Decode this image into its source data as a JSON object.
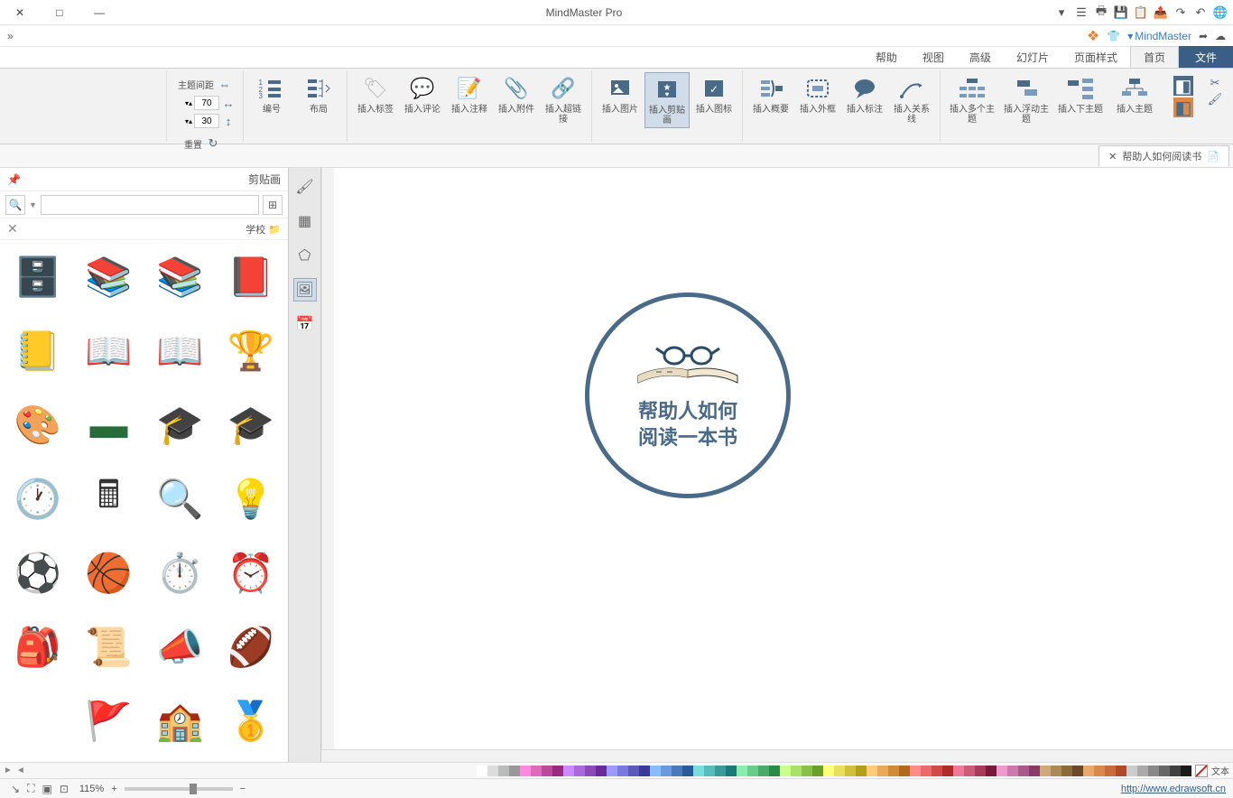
{
  "app": {
    "title": "MindMaster Pro"
  },
  "window_controls": {
    "min": "—",
    "max": "□",
    "close": "✕"
  },
  "titlebar_icons": [
    "globe",
    "undo",
    "redo",
    "export",
    "paste",
    "save",
    "print",
    "menu",
    "drop"
  ],
  "quickbar": {
    "doc_name": "MindMaster",
    "cloud": "☁",
    "share": "➦",
    "shirt": "👕",
    "logo": "❖",
    "expand": "«"
  },
  "menu": {
    "file": "文件",
    "tabs": [
      "首页",
      "页面样式",
      "幻灯片",
      "高级",
      "视图",
      "帮助"
    ]
  },
  "ribbon": {
    "groups": [
      {
        "buttons": [
          {
            "label": "插入主题",
            "icon": "topic-main"
          },
          {
            "label": "插入下主题",
            "icon": "topic-sub"
          },
          {
            "label": "插入浮动主题",
            "icon": "topic-float"
          },
          {
            "label": "插入多个主题",
            "icon": "topic-multi"
          }
        ]
      },
      {
        "buttons": [
          {
            "label": "插入关系线",
            "icon": "relation"
          },
          {
            "label": "插入标注",
            "icon": "callout"
          },
          {
            "label": "插入外框",
            "icon": "boundary"
          },
          {
            "label": "插入概要",
            "icon": "summary"
          }
        ]
      },
      {
        "buttons": [
          {
            "label": "插入图标",
            "icon": "iconinsert"
          },
          {
            "label": "插入剪贴画",
            "icon": "clipart",
            "active": true
          },
          {
            "label": "插入图片",
            "icon": "picture"
          }
        ]
      },
      {
        "buttons": [
          {
            "label": "插入超链接",
            "icon": "link"
          },
          {
            "label": "插入附件",
            "icon": "attach"
          },
          {
            "label": "插入注释",
            "icon": "note"
          },
          {
            "label": "插入评论",
            "icon": "comment"
          },
          {
            "label": "插入标签",
            "icon": "tag"
          }
        ]
      },
      {
        "small": [
          {
            "label": "布局",
            "icon": "layout"
          },
          {
            "label": "编号",
            "icon": "number"
          }
        ]
      },
      {
        "small2": [
          {
            "label": "主题间距"
          },
          {
            "w": "70",
            "h": "30"
          },
          {
            "label": "重置",
            "icon": "reset"
          }
        ]
      },
      {
        "tools": [
          "cut",
          "brush",
          "paint1",
          "paint2"
        ]
      }
    ]
  },
  "doc_tab": {
    "name": "帮助人如何阅读书",
    "close": "✕"
  },
  "node": {
    "line1": "帮助人如何",
    "line2": "阅读一本书"
  },
  "side_strip": [
    "brush",
    "tasks",
    "star",
    "clip",
    "cal"
  ],
  "clipart": {
    "title": "剪贴画",
    "category": "学校",
    "grid_icon": "⊞",
    "search_placeholder": "",
    "items": [
      {
        "name": "book-red",
        "emoji": "📕",
        "color": "#b03030"
      },
      {
        "name": "books-stack",
        "emoji": "📚",
        "color": "#2a6b3a"
      },
      {
        "name": "books-row",
        "emoji": "📚",
        "color": "#3a5e85"
      },
      {
        "name": "book-shelf",
        "emoji": "🗄️",
        "color": "#8a5a3a"
      },
      {
        "name": "books-trophy",
        "emoji": "🏆",
        "color": "#2a6b3a"
      },
      {
        "name": "book-open",
        "emoji": "📖",
        "color": "#dac9a6"
      },
      {
        "name": "book-glasses",
        "emoji": "📖",
        "color": "#dac9a6"
      },
      {
        "name": "notebook",
        "emoji": "📒",
        "color": "#e8d8a0"
      },
      {
        "name": "grad-cap1",
        "emoji": "🎓",
        "color": "#222"
      },
      {
        "name": "grad-cap2",
        "emoji": "🎓",
        "color": "#222"
      },
      {
        "name": "chalkboard",
        "emoji": "▬",
        "color": "#2a6b3a"
      },
      {
        "name": "palette",
        "emoji": "🎨",
        "color": "#d8a84a"
      },
      {
        "name": "lamp",
        "emoji": "💡",
        "color": "#3a7ec8"
      },
      {
        "name": "magnifier",
        "emoji": "🔍",
        "color": "#333"
      },
      {
        "name": "calculator",
        "emoji": "🖩",
        "color": "#333"
      },
      {
        "name": "clock",
        "emoji": "🕐",
        "color": "#888"
      },
      {
        "name": "alarm",
        "emoji": "⏰",
        "color": "#888"
      },
      {
        "name": "stopwatch",
        "emoji": "⏱️",
        "color": "#888"
      },
      {
        "name": "basketball",
        "emoji": "🏀",
        "color": "#d87a2a"
      },
      {
        "name": "soccer",
        "emoji": "⚽",
        "color": "#333"
      },
      {
        "name": "football",
        "emoji": "🏈",
        "color": "#7a4a2a"
      },
      {
        "name": "megaphone",
        "emoji": "📣",
        "color": "#3a7ec8"
      },
      {
        "name": "scroll",
        "emoji": "📜",
        "color": "#d8c89a"
      },
      {
        "name": "backpack",
        "emoji": "🎒",
        "color": "#3a7ec8"
      },
      {
        "name": "medal",
        "emoji": "🥇",
        "color": "#d8a84a"
      },
      {
        "name": "school",
        "emoji": "🏫",
        "color": "#8a5a3a"
      },
      {
        "name": "flags",
        "emoji": "🚩",
        "color": "#3a9a5a"
      }
    ]
  },
  "colorbar_label": "文本",
  "status": {
    "url": "http://www.edrawsoft.cn",
    "zoom": "115%",
    "minus": "−",
    "plus": "+"
  },
  "colors": [
    "#1a1a1a",
    "#404040",
    "#666",
    "#888",
    "#aaa",
    "#ccc",
    "#b04a2a",
    "#c86a3a",
    "#d88a4a",
    "#e8aa6a",
    "#6a4a2a",
    "#8a6a3a",
    "#aa8a5a",
    "#ccaa7a",
    "#8a3a6a",
    "#aa5a8a",
    "#cc7aaa",
    "#ee9acc",
    "#7a1a3a",
    "#aa3a5a",
    "#cc5a7a",
    "#ee7a9a",
    "#b02a2a",
    "#d04a4a",
    "#e86a6a",
    "#ff8a8a",
    "#b06a1a",
    "#d08a3a",
    "#e8aa5a",
    "#ffca7a",
    "#b0a01a",
    "#d0c03a",
    "#e8e05a",
    "#ffff7a",
    "#6aa02a",
    "#8ac04a",
    "#aae06a",
    "#ccff8a",
    "#2a8a4a",
    "#4aaa6a",
    "#6acc8a",
    "#8aeeaa",
    "#1a7a7a",
    "#3a9a9a",
    "#5abbbb",
    "#7adddd",
    "#2a5a9a",
    "#4a7abb",
    "#6a9add",
    "#8abaff",
    "#3a3a9a",
    "#5a5abb",
    "#7a7add",
    "#9a9aff",
    "#6a2a9a",
    "#8a4abb",
    "#aa6add",
    "#cc8aff",
    "#9a2a7a",
    "#bb4a9a",
    "#dd6abb",
    "#ff8add",
    "#999",
    "#bbb",
    "#ddd",
    "#fff"
  ]
}
